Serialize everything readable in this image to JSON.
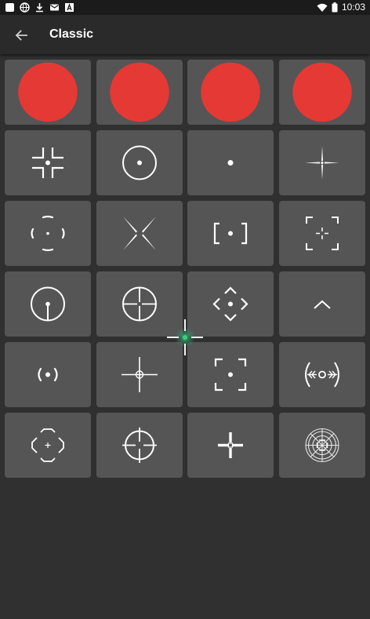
{
  "status_bar": {
    "time": "10:03",
    "left_icons": [
      "square-icon",
      "globe-icon",
      "download-icon",
      "mail-icon",
      "font-icon"
    ],
    "right_icons": [
      "wifi-icon",
      "battery-icon"
    ]
  },
  "app_bar": {
    "title": "Classic",
    "back_icon": "arrow-left-icon"
  },
  "accent": {
    "badge_color": "#e53935",
    "glow_color": "#2e9e6a"
  },
  "crosshairs": [
    {
      "id": "circle-broken-dot",
      "badge": true
    },
    {
      "id": "plus-gap-dot",
      "badge": true
    },
    {
      "id": "circle-tee",
      "badge": true
    },
    {
      "id": "x-diagonal",
      "badge": true
    },
    {
      "id": "corner-brackets-dot",
      "badge": false
    },
    {
      "id": "circle-dot",
      "badge": false
    },
    {
      "id": "dot-only",
      "badge": false
    },
    {
      "id": "thin-plus-dot",
      "badge": false
    },
    {
      "id": "broken-oval-dot",
      "badge": false
    },
    {
      "id": "x-long",
      "badge": false
    },
    {
      "id": "square-brackets-dot",
      "badge": false
    },
    {
      "id": "corners-small-plus",
      "badge": false
    },
    {
      "id": "circle-tee-bottom",
      "badge": false
    },
    {
      "id": "circle-crosshair",
      "badge": false
    },
    {
      "id": "chevrons-diamond",
      "badge": false
    },
    {
      "id": "caret-up",
      "badge": false
    },
    {
      "id": "parens-dot",
      "badge": false
    },
    {
      "id": "plus-small-circle",
      "badge": false
    },
    {
      "id": "corner-frame-dot",
      "badge": false
    },
    {
      "id": "sonar-arrows",
      "badge": false
    },
    {
      "id": "diamond-brackets-plus",
      "badge": false
    },
    {
      "id": "circle-crosshair-gap",
      "badge": false
    },
    {
      "id": "thick-plus-square",
      "badge": false
    },
    {
      "id": "scope-reticle",
      "badge": false
    }
  ]
}
